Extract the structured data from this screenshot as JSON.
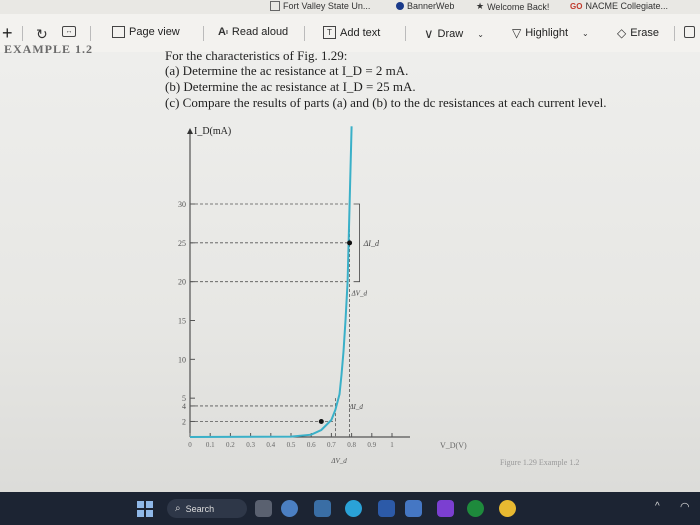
{
  "bookmarks": {
    "items": [
      {
        "label": "Fort Valley State Un..."
      },
      {
        "label": "BannerWeb"
      },
      {
        "label": "Welcome Back!"
      },
      {
        "label": "NACME Collegiate..."
      }
    ],
    "nacme_prefix": "GO"
  },
  "toolbar": {
    "page_view": "Page view",
    "read_aloud": "Read aloud",
    "add_text": "Add text",
    "draw": "Draw",
    "highlight": "Highlight",
    "erase": "Erase"
  },
  "document": {
    "example_label": "EXAMPLE 1.2",
    "lines": [
      "For the characteristics of Fig. 1.29:",
      "(a) Determine the ac resistance at I_D = 2 mA.",
      "(b) Determine the ac resistance at I_D = 25 mA.",
      "(c) Compare the results of parts (a) and (b) to the dc resistances at each current level."
    ],
    "caption": "Figure 1.29   Example 1.2"
  },
  "chart_data": {
    "type": "line",
    "ylabel": "I_D(mA)",
    "xlabel": "V_D(V)",
    "x_ticks": [
      "0",
      "0.1",
      "0.2",
      "0.3",
      "0.4",
      "0.5",
      "0.6",
      "0.7",
      "0.8",
      "0.9",
      "1"
    ],
    "y_ticks": [
      "2",
      "4",
      "5",
      "10",
      "15",
      "20",
      "25",
      "30"
    ],
    "xlim": [
      0,
      1
    ],
    "ylim": [
      0,
      33
    ],
    "series": [
      {
        "x": [
          0.0,
          0.5,
          0.6,
          0.65,
          0.7,
          0.72,
          0.74,
          0.75,
          0.76,
          0.77,
          0.78,
          0.785,
          0.79,
          0.8
        ],
        "y": [
          0,
          0.05,
          0.3,
          0.9,
          2.2,
          3.5,
          5.5,
          8,
          11,
          15,
          20,
          25,
          30,
          40
        ]
      }
    ],
    "marked_points": [
      {
        "x": 0.65,
        "y": 2
      },
      {
        "x": 0.79,
        "y": 25
      }
    ],
    "annotations": [
      "ΔI_d",
      "ΔV_d",
      "ΔI_d",
      "ΔV_d"
    ]
  },
  "taskbar": {
    "search_placeholder": "Search"
  }
}
